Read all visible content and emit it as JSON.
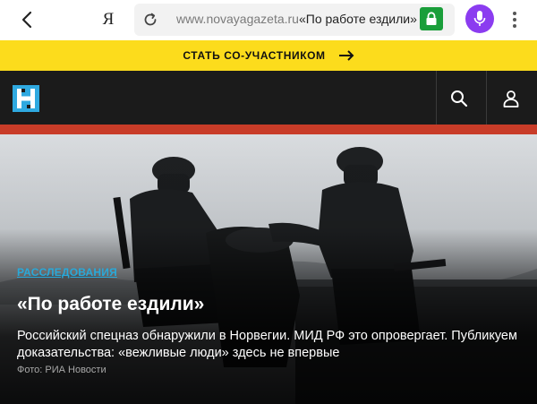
{
  "browser": {
    "url_domain": "www.novayagazeta.ru",
    "page_title": "«По работе ездили»",
    "yandex_glyph": "Я",
    "icons": [
      "back-arrow-icon",
      "yandex-icon",
      "reload-icon",
      "lock-icon",
      "microphone-icon",
      "more-vertical-icon"
    ],
    "accent_colors": {
      "lock": "#1a9e3a",
      "mic": "#8b3cf0"
    }
  },
  "promo": {
    "label": "СТАТЬ СО-УЧАСТНИКОМ",
    "icon": "arrow-right-icon",
    "background": "#fcdc1c"
  },
  "site_header": {
    "logo_icon": "novaya-gazeta-logo",
    "icons": [
      "search-icon",
      "user-icon"
    ],
    "background": "#1b1b1b",
    "stripe_color": "#c83c28"
  },
  "article": {
    "kicker": "РАССЛЕДОВАНИЯ",
    "title": "«По работе ездили»",
    "lede": "Российский спецназ обнаружили в Норвегии. МИД РФ это опровергает. Публикуем доказательства: «вежливые люди» здесь не впервые",
    "photo_credit": "Фото: РИА Новости",
    "kicker_color": "#29a9d9"
  }
}
